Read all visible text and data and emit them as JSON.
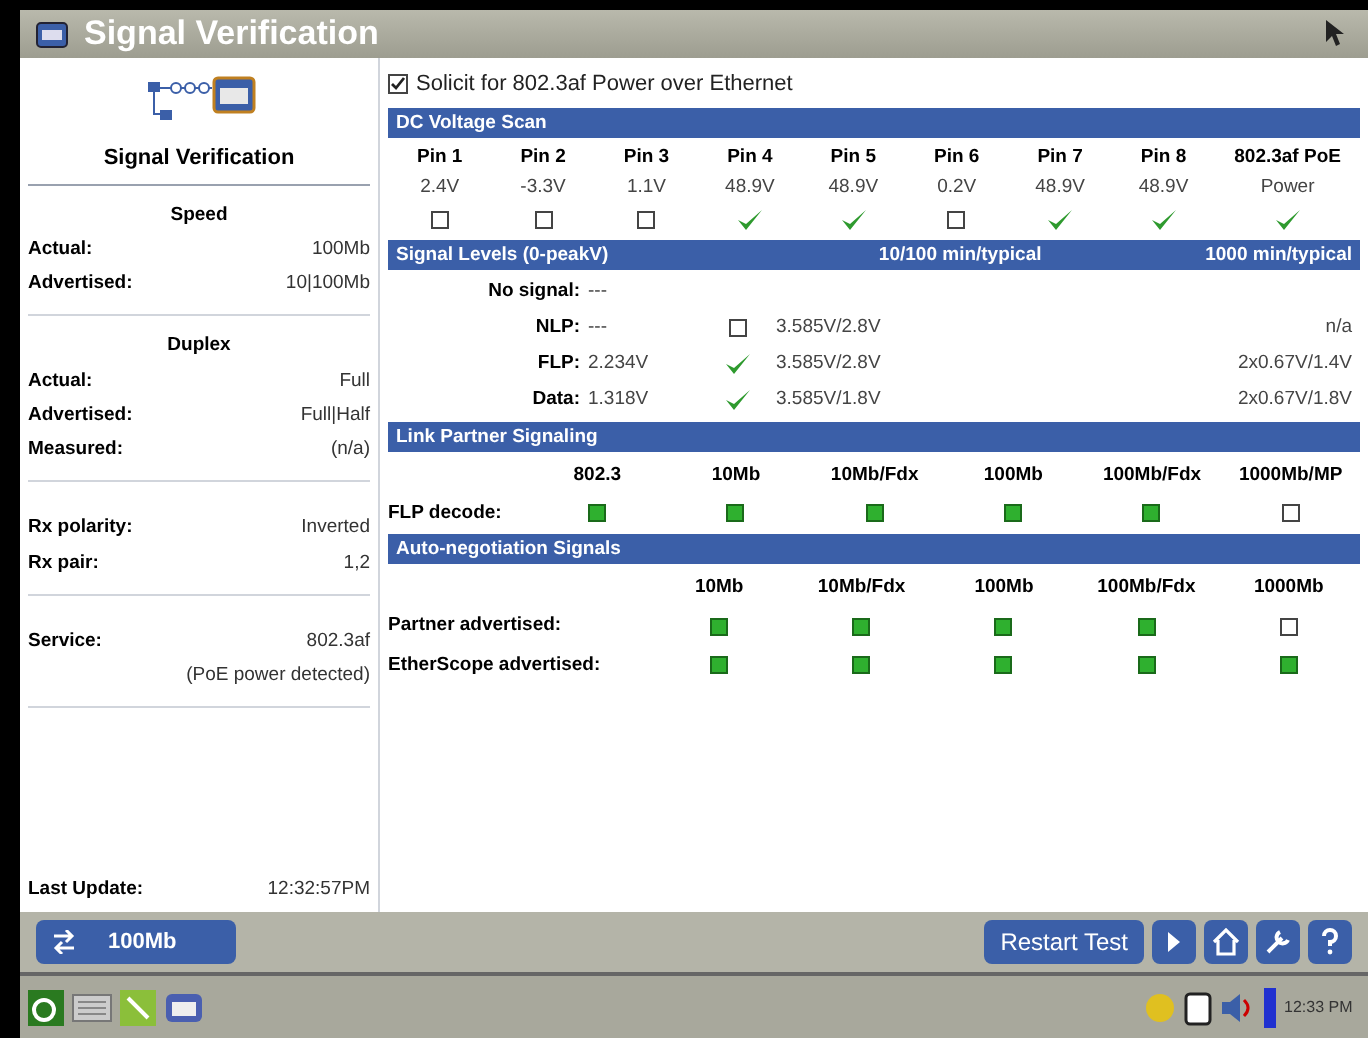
{
  "window": {
    "title": "Signal Verification"
  },
  "sidebar": {
    "title": "Signal Verification",
    "groups": [
      {
        "heading": "Speed",
        "rows": [
          {
            "label": "Actual:",
            "value": "100Mb"
          },
          {
            "label": "Advertised:",
            "value": "10|100Mb"
          }
        ]
      },
      {
        "heading": "Duplex",
        "rows": [
          {
            "label": "Actual:",
            "value": "Full"
          },
          {
            "label": "Advertised:",
            "value": "Full|Half"
          },
          {
            "label": "Measured:",
            "value": "(n/a)"
          }
        ]
      },
      {
        "rows": [
          {
            "label": "Rx polarity:",
            "value": "Inverted"
          },
          {
            "label": "Rx pair:",
            "value": "1,2"
          }
        ]
      },
      {
        "rows": [
          {
            "label": "Service:",
            "value": "802.3af"
          }
        ],
        "note": "(PoE power detected)"
      }
    ],
    "last_update": {
      "label": "Last Update:",
      "value": "12:32:57PM"
    }
  },
  "solicit": {
    "label": "Solicit for 802.3af Power over Ethernet",
    "checked": true
  },
  "voltage_scan": {
    "title": "DC Voltage Scan",
    "columns": [
      {
        "label": "Pin 1",
        "reading": "2.4V",
        "checked": false
      },
      {
        "label": "Pin 2",
        "reading": "-3.3V",
        "checked": false
      },
      {
        "label": "Pin 3",
        "reading": "1.1V",
        "checked": false
      },
      {
        "label": "Pin 4",
        "reading": "48.9V",
        "checked": true
      },
      {
        "label": "Pin 5",
        "reading": "48.9V",
        "checked": true
      },
      {
        "label": "Pin 6",
        "reading": "0.2V",
        "checked": false
      },
      {
        "label": "Pin 7",
        "reading": "48.9V",
        "checked": true
      },
      {
        "label": "Pin 8",
        "reading": "48.9V",
        "checked": true
      },
      {
        "label": "802.3af PoE",
        "reading": "Power",
        "checked": true
      }
    ]
  },
  "signal_levels": {
    "title": "Signal Levels (0-peakV)",
    "header_2": "10/100 min/typical",
    "header_3": "1000 min/typical",
    "rows": [
      {
        "kind": "plain",
        "label": "No signal:",
        "reading": "---"
      },
      {
        "kind": "check",
        "label": "NLP:",
        "reading": "---",
        "checked": false,
        "typical_100": "3.585V/2.8V",
        "typical_1000": "n/a"
      },
      {
        "kind": "check",
        "label": "FLP:",
        "reading": "2.234V",
        "checked": true,
        "typical_100": "3.585V/2.8V",
        "typical_1000": "2x0.67V/1.4V"
      },
      {
        "kind": "check",
        "label": "Data:",
        "reading": "1.318V",
        "checked": true,
        "typical_100": "3.585V/1.8V",
        "typical_1000": "2x0.67V/1.8V"
      }
    ]
  },
  "link_partner": {
    "title": "Link Partner Signaling",
    "columns": [
      "802.3",
      "10Mb",
      "10Mb/Fdx",
      "100Mb",
      "100Mb/Fdx",
      "1000Mb/MP"
    ],
    "rows": [
      {
        "label": "FLP decode:",
        "cells": [
          true,
          true,
          true,
          true,
          true,
          false
        ]
      }
    ]
  },
  "auto_negotiation": {
    "title": "Auto-negotiation Signals",
    "columns": [
      "10Mb",
      "10Mb/Fdx",
      "100Mb",
      "100Mb/Fdx",
      "1000Mb"
    ],
    "rows": [
      {
        "label": "Partner advertised:",
        "cells": [
          true,
          true,
          true,
          true,
          false
        ]
      },
      {
        "label": "EtherScope advertised:",
        "cells": [
          true,
          true,
          true,
          true,
          true
        ]
      }
    ]
  },
  "toolbar": {
    "speed_button": "100Mb",
    "restart_button": "Restart Test"
  },
  "taskbar": {
    "time": "12:33 PM"
  }
}
